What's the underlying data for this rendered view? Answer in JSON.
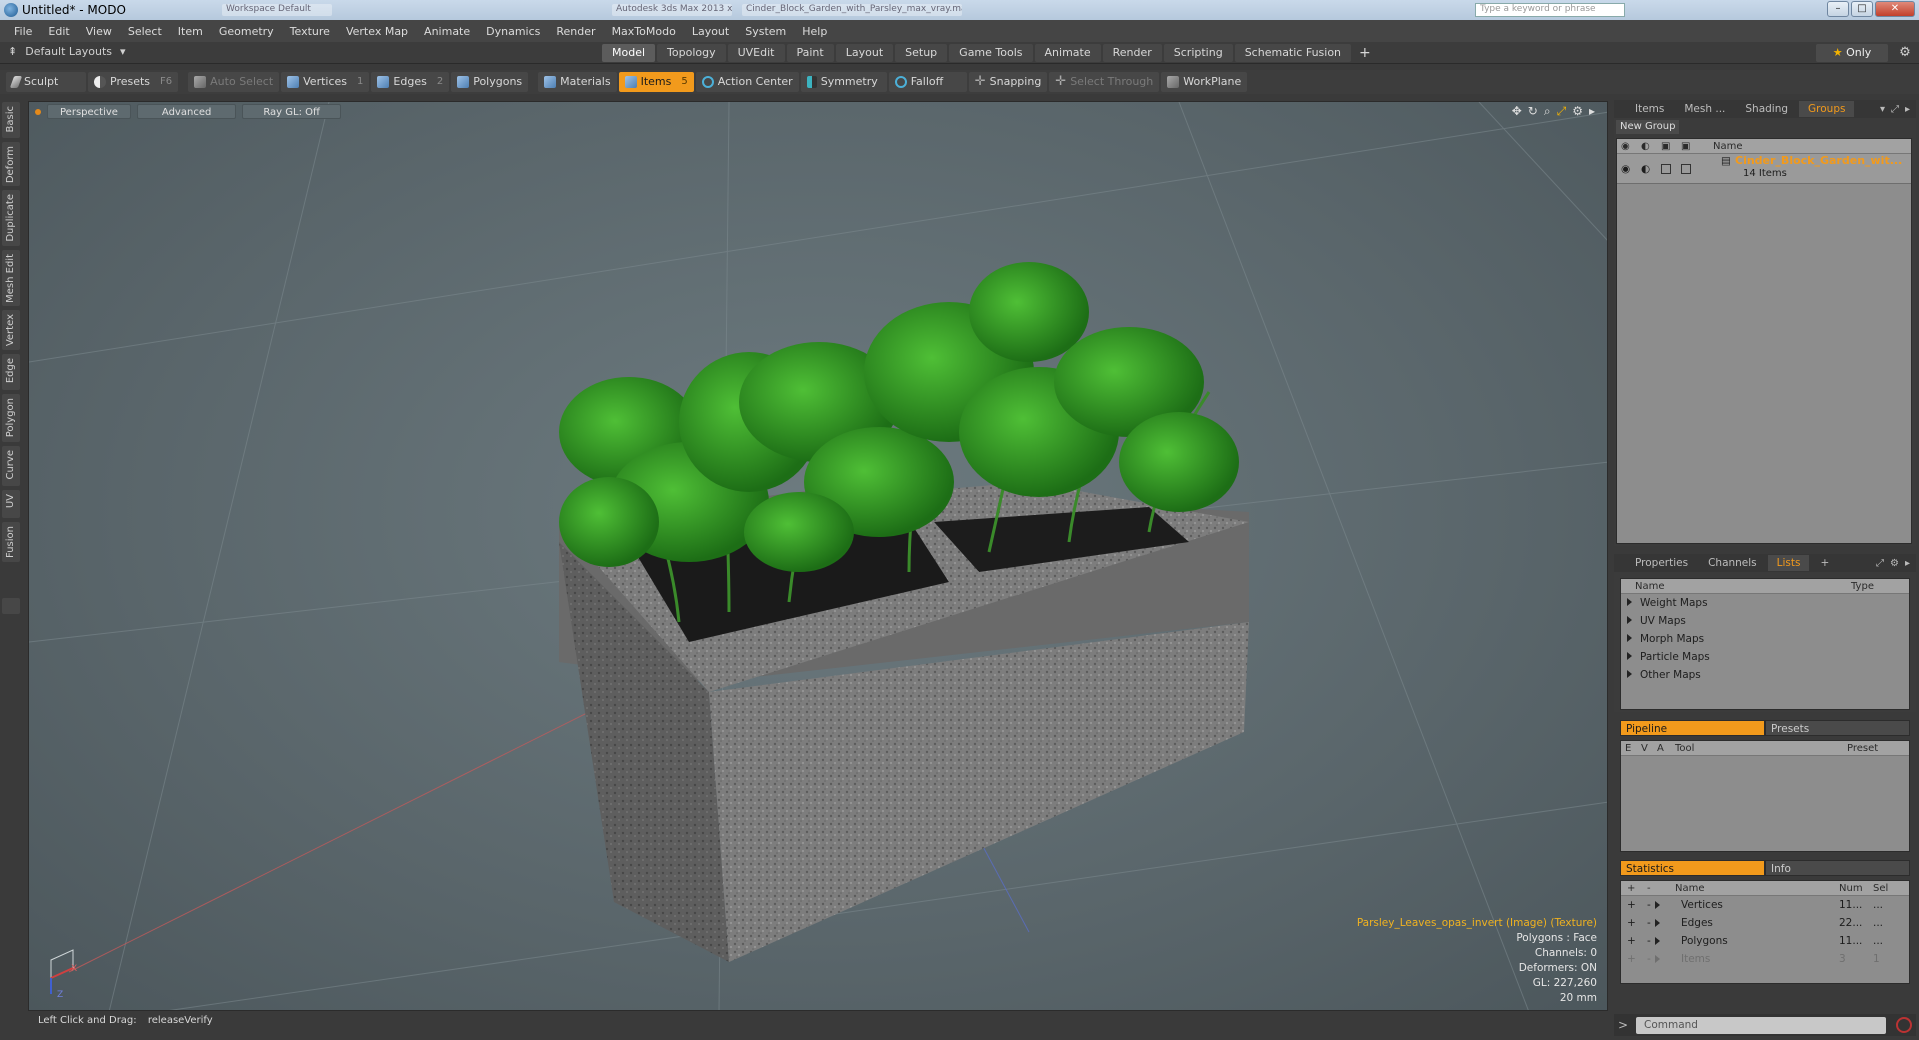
{
  "window": {
    "title": "Untitled* - MODO",
    "ghost_text_1": "Workspace Default",
    "ghost_text_2": "Autodesk 3ds Max 2013 x64",
    "ghost_text_3": "Cinder_Block_Garden_with_Parsley_max_vray.max",
    "ghost_search": "Type a keyword or phrase",
    "minimize": "–",
    "maximize": "□",
    "close": "✕"
  },
  "menubar": [
    "File",
    "Edit",
    "View",
    "Select",
    "Item",
    "Geometry",
    "Texture",
    "Vertex Map",
    "Animate",
    "Dynamics",
    "Render",
    "MaxToModo",
    "Layout",
    "System",
    "Help"
  ],
  "layouts": {
    "dropdown_label": "Default Layouts",
    "tabs": [
      "Model",
      "Topology",
      "UVEdit",
      "Paint",
      "Layout",
      "Setup",
      "Game Tools",
      "Animate",
      "Render",
      "Scripting",
      "Schematic Fusion"
    ],
    "active_tab": "Model",
    "plus": "+",
    "only_label": "Only",
    "star": "★"
  },
  "toolbar": {
    "sculpt": "Sculpt",
    "presets": "Presets",
    "presets_key": "F6",
    "auto_select": "Auto Select",
    "vertices": "Vertices",
    "vertices_key": "1",
    "edges": "Edges",
    "edges_key": "2",
    "polygons": "Polygons",
    "materials": "Materials",
    "items": "Items",
    "items_key": "5",
    "action_center": "Action Center",
    "symmetry": "Symmetry",
    "falloff": "Falloff",
    "snapping": "Snapping",
    "select_through": "Select Through",
    "workplane": "WorkPlane"
  },
  "left_tabs": [
    "Basic",
    "Deform",
    "Duplicate",
    "Mesh Edit",
    "Vertex",
    "Edge",
    "Polygon",
    "Curve",
    "UV",
    "Fusion"
  ],
  "viewport": {
    "perspective": "Perspective",
    "advanced": "Advanced",
    "raygl": "Ray GL: Off",
    "info_texture": "Parsley_Leaves_opas_invert (Image) (Texture)",
    "info_polygons": "Polygons : Face",
    "info_channels": "Channels: 0",
    "info_deformers": "Deformers: ON",
    "info_gl": "GL: 227,260",
    "info_scale": "20 mm",
    "axis_x": "X",
    "axis_z": "Z"
  },
  "status": {
    "hint": "Left Click and Drag:",
    "action": "releaseVerify"
  },
  "groups_panel": {
    "tabs": [
      "Items",
      "Mesh ...",
      "Shading",
      "Groups"
    ],
    "active": "Groups",
    "new_group": "New Group",
    "col_name": "Name",
    "group_name": "Cinder_Block_Garden_wit...",
    "group_count": "14 Items"
  },
  "lists_panel": {
    "tabs": [
      "Properties",
      "Channels",
      "Lists"
    ],
    "active": "Lists",
    "plus": "+",
    "col_name": "Name",
    "col_type": "Type",
    "rows": [
      "Weight Maps",
      "UV Maps",
      "Morph Maps",
      "Particle Maps",
      "Other Maps"
    ]
  },
  "pipeline_panel": {
    "pipeline": "Pipeline",
    "presets": "Presets",
    "col_e": "E",
    "col_v": "V",
    "col_a": "A",
    "col_tool": "Tool",
    "col_preset": "Preset"
  },
  "stats_panel": {
    "statistics": "Statistics",
    "info": "Info",
    "col_plus": "+",
    "col_minus": "-",
    "col_name": "Name",
    "col_num": "Num",
    "col_sel": "Sel",
    "rows": [
      {
        "plus": "+",
        "minus": "-",
        "name": "Vertices",
        "num": "11...",
        "sel": "..."
      },
      {
        "plus": "+",
        "minus": "-",
        "name": "Edges",
        "num": "22...",
        "sel": "..."
      },
      {
        "plus": "+",
        "minus": "-",
        "name": "Polygons",
        "num": "11...",
        "sel": "..."
      },
      {
        "plus": "+",
        "minus": "-",
        "name": "Items",
        "num": "3",
        "sel": "1"
      }
    ]
  },
  "command": {
    "prompt": ">",
    "placeholder": "Command"
  }
}
